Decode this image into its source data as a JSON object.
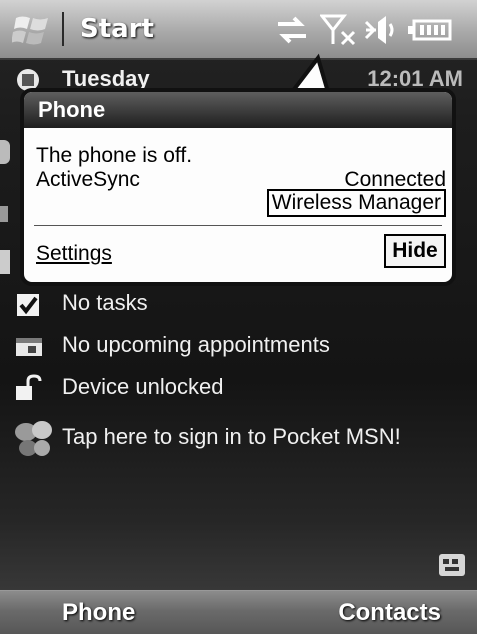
{
  "titlebar": {
    "start_label": "Start"
  },
  "status_icons": [
    "sync-arrows-icon",
    "signal-off-icon",
    "speaker-icon",
    "battery-icon"
  ],
  "today": {
    "date": "Tuesday",
    "time": "12:01 AM",
    "items": [
      {
        "icon": "checkbox-tasks-icon",
        "label": "No tasks"
      },
      {
        "icon": "calendar-icon",
        "label": "No upcoming appointments"
      },
      {
        "icon": "unlock-icon",
        "label": "Device unlocked"
      },
      {
        "icon": "msn-butterfly-icon",
        "label": "Tap here to sign in to Pocket MSN!"
      }
    ]
  },
  "popup": {
    "title": "Phone",
    "message": "The phone is off.",
    "activesync_label": "ActiveSync",
    "activesync_status": "Connected",
    "wireless_manager_link": "Wireless Manager",
    "settings_link": "Settings",
    "hide_button": "Hide"
  },
  "softkeys": {
    "left": "Phone",
    "right": "Contacts"
  }
}
